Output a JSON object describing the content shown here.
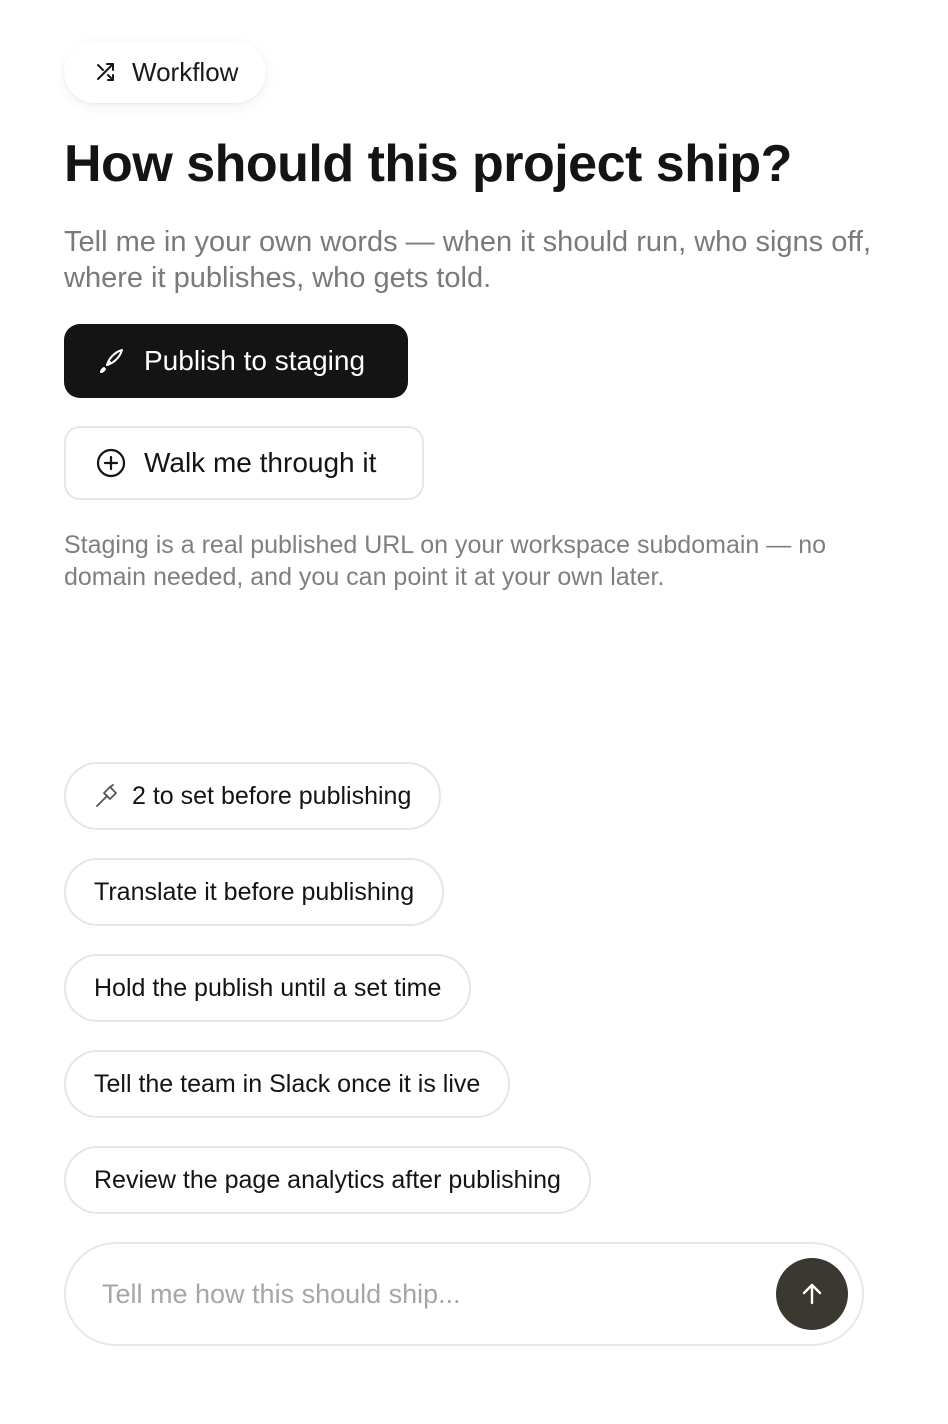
{
  "header": {
    "chip_label": "Workflow",
    "chip_icon": "shuffle-icon"
  },
  "main": {
    "title": "How should this project ship?",
    "subtitle": "Tell me in your own words — when it should run, who signs off, where it publishes, who gets told.",
    "primary_button": {
      "label": "Publish to staging",
      "icon": "rocket-icon"
    },
    "secondary_button": {
      "label": "Walk me through it",
      "icon": "plus-circle-icon"
    },
    "note": "Staging is a real published URL on your workspace subdomain — no domain needed, and you can point it at your own later."
  },
  "suggestions": {
    "setup_pill": {
      "label": "2 to set before publishing",
      "icon": "hammer-icon"
    },
    "items": [
      {
        "label": "Translate it before publishing"
      },
      {
        "label": "Hold the publish until a set time"
      },
      {
        "label": "Tell the team in Slack once it is live"
      },
      {
        "label": "Review the page analytics after publishing"
      }
    ]
  },
  "composer": {
    "placeholder": "Tell me how this should ship...",
    "value": "",
    "send_icon": "arrow-up-icon"
  },
  "colors": {
    "primary_button_bg": "#141414",
    "send_button_bg": "#3b3832",
    "muted_text": "#7a7a7a",
    "border": "#e6e6e6"
  }
}
